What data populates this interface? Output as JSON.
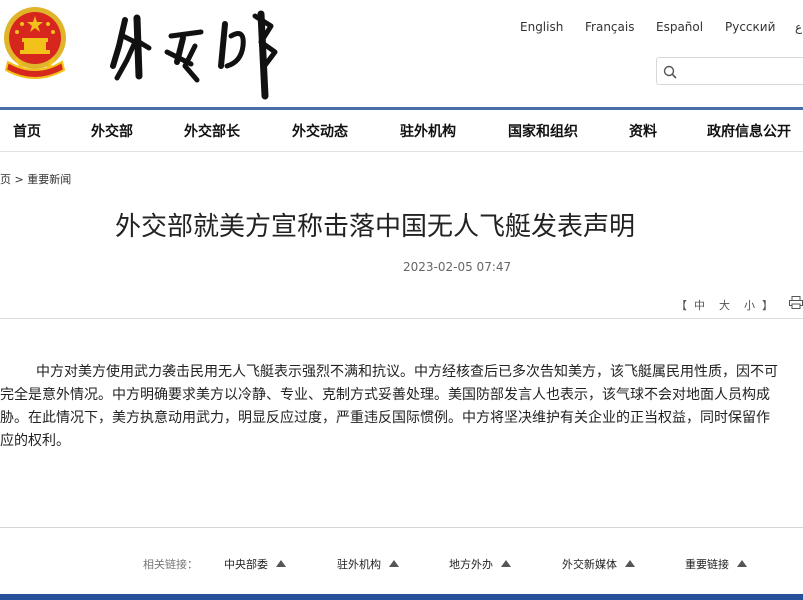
{
  "header": {
    "languages": [
      "English",
      "Français",
      "Español",
      "Русский",
      "ﻉ"
    ],
    "search": {
      "placeholder": ""
    }
  },
  "nav": {
    "items": [
      "首页",
      "外交部",
      "外交部长",
      "外交动态",
      "驻外机构",
      "国家和组织",
      "资料",
      "政府信息公开"
    ]
  },
  "breadcrumb": {
    "home": "页",
    "separator": ">",
    "current": "重要新闻"
  },
  "article": {
    "title": "外交部就美方宣称击落中国无人飞艇发表声明",
    "date": "2023-02-05 07:47",
    "font_tools": {
      "open": "【",
      "small": "中",
      "medium": "大",
      "large": "小",
      "close": "】"
    },
    "lines": [
      "中方对美方使用武力袭击民用无人飞艇表示强烈不满和抗议。中方经核查后已多次告知美方，该飞艇属民用性质，因不可",
      "完全是意外情况。中方明确要求美方以冷静、专业、克制方式妥善处理。美国防部发言人也表示，该气球不会对地面人员构成",
      "胁。在此情况下，美方执意动用武力，明显反应过度，严重违反国际惯例。中方将坚决维护有关企业的正当权益，同时保留作",
      "应的权利。"
    ]
  },
  "footer": {
    "related_label": "相关链接：",
    "links": [
      "中央部委",
      "驻外机构",
      "地方外办",
      "外交新媒体",
      "重要链接"
    ]
  },
  "colors": {
    "nav_line": "#4a6fa8",
    "bottom_bar": "#26509a",
    "emblem_red": "#d7261e",
    "emblem_gold": "#f2c11a"
  }
}
